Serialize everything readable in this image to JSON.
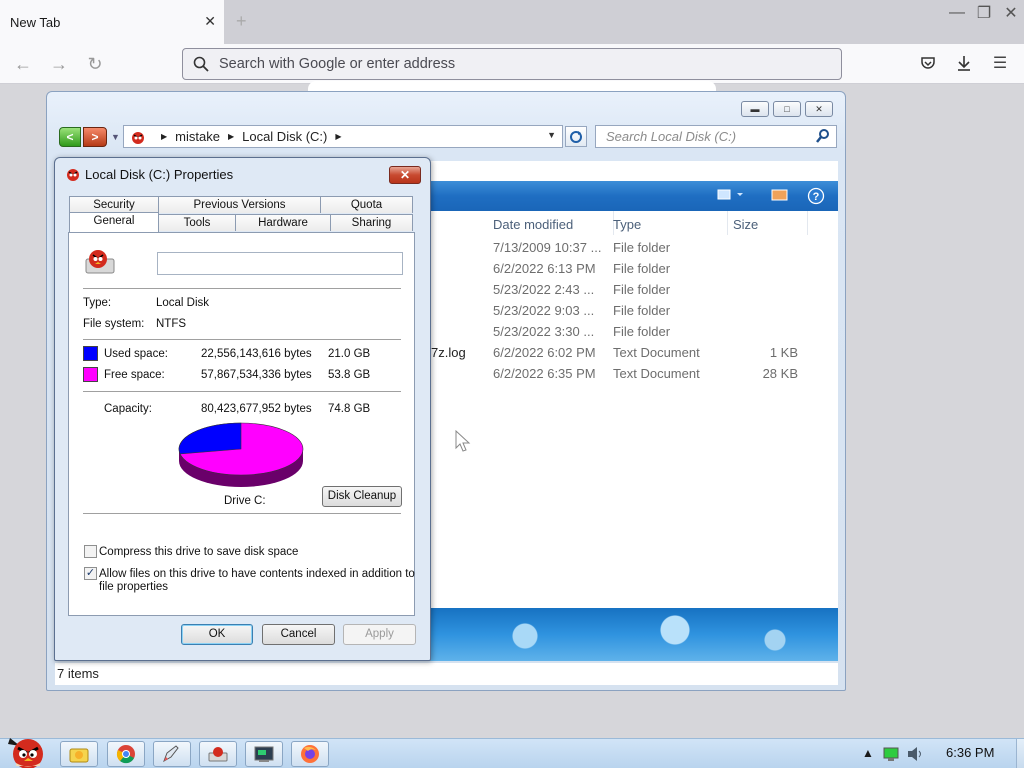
{
  "browser": {
    "tab_title": "New Tab",
    "tab_close": "✕",
    "new_tab": "+",
    "url_placeholder": "Search with Google or enter address"
  },
  "explorer": {
    "breadcrumb": [
      "mistake",
      "Local Disk (C:)"
    ],
    "search_placeholder": "Search Local Disk (C:)",
    "columns": [
      "Date modified",
      "Type",
      "Size"
    ],
    "rows": [
      {
        "name": "",
        "date": "7/13/2009 10:37 ...",
        "type": "File folder",
        "size": ""
      },
      {
        "name": "",
        "date": "6/2/2022 6:13 PM",
        "type": "File folder",
        "size": ""
      },
      {
        "name": "",
        "date": "5/23/2022 2:43 ...",
        "type": "File folder",
        "size": ""
      },
      {
        "name": "",
        "date": "5/23/2022 9:03 ...",
        "type": "File folder",
        "size": ""
      },
      {
        "name": "",
        "date": "5/23/2022 3:30 ...",
        "type": "File folder",
        "size": ""
      },
      {
        "name": "7z.log",
        "date": "6/2/2022 6:02 PM",
        "type": "Text Document",
        "size": "1 KB"
      },
      {
        "name": "",
        "date": "6/2/2022 6:35 PM",
        "type": "Text Document",
        "size": "28 KB"
      }
    ],
    "status": "7 items"
  },
  "properties": {
    "title": "Local Disk (C:) Properties",
    "close": "✕",
    "tabs_top": [
      "Security",
      "Previous Versions",
      "Quota"
    ],
    "tabs_bottom": [
      "General",
      "Tools",
      "Hardware",
      "Sharing"
    ],
    "drive_name_value": "",
    "type_label": "Type:",
    "type_value": "Local Disk",
    "fs_label": "File system:",
    "fs_value": "NTFS",
    "used_label": "Used space:",
    "used_bytes": "22,556,143,616 bytes",
    "used_gb": "21.0 GB",
    "free_label": "Free space:",
    "free_bytes": "57,867,534,336 bytes",
    "free_gb": "53.8 GB",
    "capacity_label": "Capacity:",
    "capacity_bytes": "80,423,677,952 bytes",
    "capacity_gb": "74.8 GB",
    "used_fraction": 0.2805,
    "used_color": "#0000ff",
    "free_color": "#ff00ff",
    "drive_label": "Drive C:",
    "disk_cleanup": "Disk Cleanup",
    "compress_label": "Compress this drive to save disk space",
    "compress_checked": false,
    "index_label_1": "Allow files on this drive to have contents indexed in addition to",
    "index_label_2": "file properties",
    "index_checked": true,
    "check_mark": "✓",
    "ok": "OK",
    "cancel": "Cancel",
    "apply": "Apply"
  },
  "taskbar": {
    "clock": "6:36 PM"
  }
}
